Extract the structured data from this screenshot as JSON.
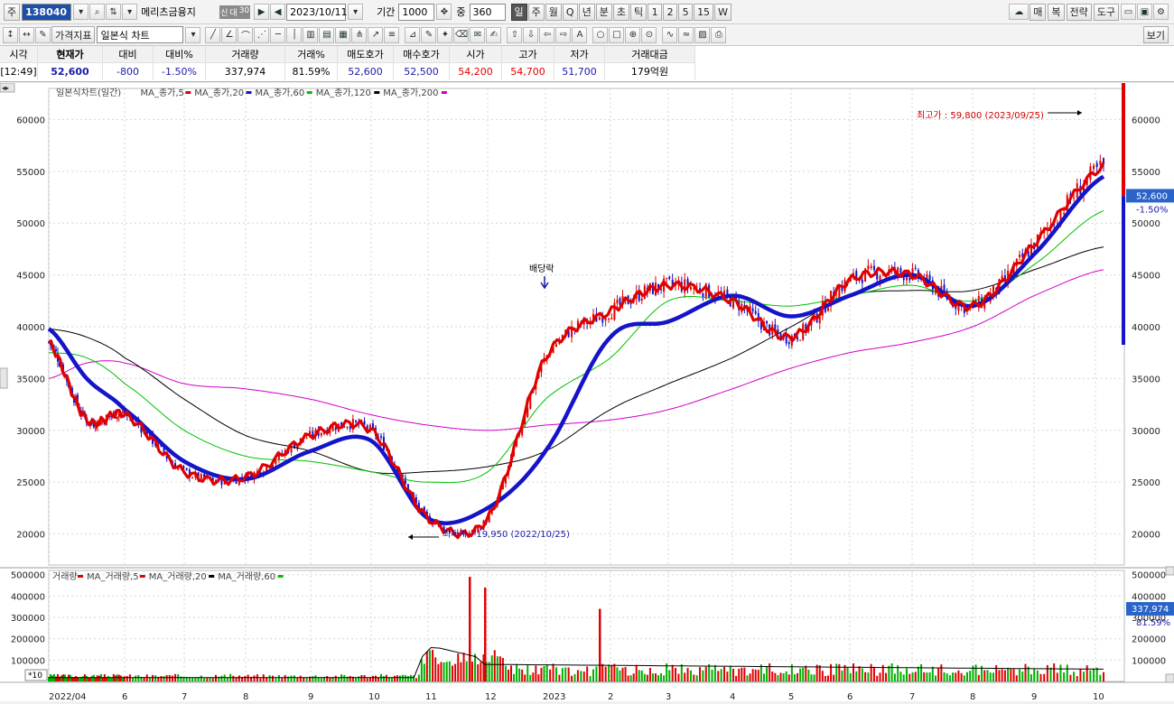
{
  "toolbar1": {
    "market_label": "주",
    "stock_code": "138040",
    "stock_name": "메리츠금융지",
    "stock_badges": [
      "신",
      "대",
      "30"
    ],
    "date": "2023/10/11",
    "period_label": "기간",
    "period_value": "1000",
    "overlap_label": "중",
    "overlap_value": "360",
    "timeframes": [
      "일",
      "주",
      "월",
      "Q",
      "년",
      "분",
      "초",
      "틱",
      "1",
      "2",
      "5",
      "15",
      "W"
    ],
    "timeframe_selected": "일",
    "right_buttons": [
      "매",
      "복",
      "전략",
      "도구"
    ]
  },
  "toolbar2": {
    "indicator_label": "가격지표",
    "chart_type": "일본식 차트",
    "view_button": "보기"
  },
  "quote": {
    "headers": [
      "시각",
      "현재가",
      "대비",
      "대비%",
      "거래량",
      "거래%",
      "매도호가",
      "매수호가",
      "시가",
      "고가",
      "저가",
      "거래대금"
    ],
    "values": [
      "[12:49]",
      "52,600",
      "-800",
      "-1.50%",
      "337,974",
      "81.59%",
      "52,600",
      "52,500",
      "54,200",
      "54,700",
      "51,700",
      "179억원"
    ]
  },
  "price_panel": {
    "legend": [
      "일본식차트(일간)",
      "MA_종가,5",
      "MA_종가,20",
      "MA_종가,60",
      "MA_종가,120",
      "MA_종가,200"
    ],
    "y_ticks": [
      "60000",
      "55000",
      "50000",
      "45000",
      "40000",
      "35000",
      "30000",
      "25000",
      "20000"
    ],
    "high_annotation": "최고가 : 59,800 (2023/09/25)",
    "low_annotation": "최저가 : 19,950 (2022/10/25)",
    "dividend_label": "배당락",
    "current_price_tag": "52,600",
    "current_change_tag": "-1.50%"
  },
  "volume_panel": {
    "legend": [
      "거래량",
      "MA_거래량,5",
      "MA_거래량,20",
      "MA_거래량,60"
    ],
    "y_ticks": [
      "500000",
      "400000",
      "300000",
      "200000",
      "100000"
    ],
    "multiplier": "*10",
    "current_volume_tag": "337,974",
    "current_ratio_tag": "81.59%"
  },
  "x_axis": {
    "labels": [
      "2022/04",
      "6",
      "7",
      "8",
      "9",
      "10",
      "11",
      "12",
      "2023",
      "2",
      "3",
      "4",
      "5",
      "6",
      "7",
      "8",
      "9",
      "10"
    ]
  },
  "colors": {
    "ma5": "#e00000",
    "ma20": "#1414c8",
    "ma60": "#00c000",
    "ma120": "#000000",
    "ma200": "#d000c8",
    "candle_up": "#e00000",
    "candle_down": "#1414c8",
    "vol_up": "#e00000",
    "vol_down": "#00b000"
  },
  "chart_data": {
    "type": "line",
    "title": "일본식차트(일간)",
    "ylim": [
      17000,
      63000
    ],
    "x": [
      "2022/04",
      "2022/05",
      "2022/06",
      "2022/07",
      "2022/08",
      "2022/09",
      "2022/10",
      "2022/11",
      "2022/12",
      "2023/01",
      "2023/02",
      "2023/03",
      "2023/04",
      "2023/05",
      "2023/06",
      "2023/07",
      "2023/08",
      "2023/09",
      "2023/10"
    ],
    "series": [
      {
        "name": "MA_종가,5",
        "values": [
          38500,
          31000,
          31500,
          26000,
          25500,
          29500,
          30000,
          21500,
          21500,
          37000,
          41500,
          44000,
          42500,
          39000,
          44500,
          45000,
          42000,
          48000,
          55500
        ]
      },
      {
        "name": "MA_종가,20",
        "values": [
          39800,
          35000,
          32000,
          27000,
          25300,
          28000,
          29000,
          21500,
          22500,
          28000,
          39000,
          40500,
          43000,
          41000,
          43000,
          45000,
          42000,
          47000,
          54500
        ]
      },
      {
        "name": "MA_종가,60",
        "values": [
          37500,
          37000,
          34500,
          30000,
          27500,
          27000,
          26000,
          25000,
          26000,
          33000,
          37000,
          42500,
          42500,
          42000,
          43000,
          44000,
          42500,
          46000,
          51200
        ]
      },
      {
        "name": "MA_종가,120",
        "values": [
          39800,
          39000,
          37000,
          33000,
          29500,
          28000,
          26000,
          26000,
          26500,
          28000,
          32000,
          34500,
          37000,
          40000,
          43000,
          43500,
          43500,
          45500,
          47700
        ]
      },
      {
        "name": "MA_종가,200",
        "values": [
          35000,
          36500,
          36500,
          34500,
          34000,
          33000,
          31500,
          30500,
          30000,
          30500,
          31000,
          32000,
          34000,
          36000,
          37500,
          38500,
          40000,
          43000,
          45500
        ]
      }
    ],
    "volume": {
      "ylim": [
        0,
        520000
      ],
      "highlights": [
        {
          "date": "2022/11",
          "value": 490000
        },
        {
          "date": "2022/12",
          "value": 440000
        },
        {
          "date": "2023/01",
          "value": 340000
        }
      ],
      "last": 337974
    }
  }
}
